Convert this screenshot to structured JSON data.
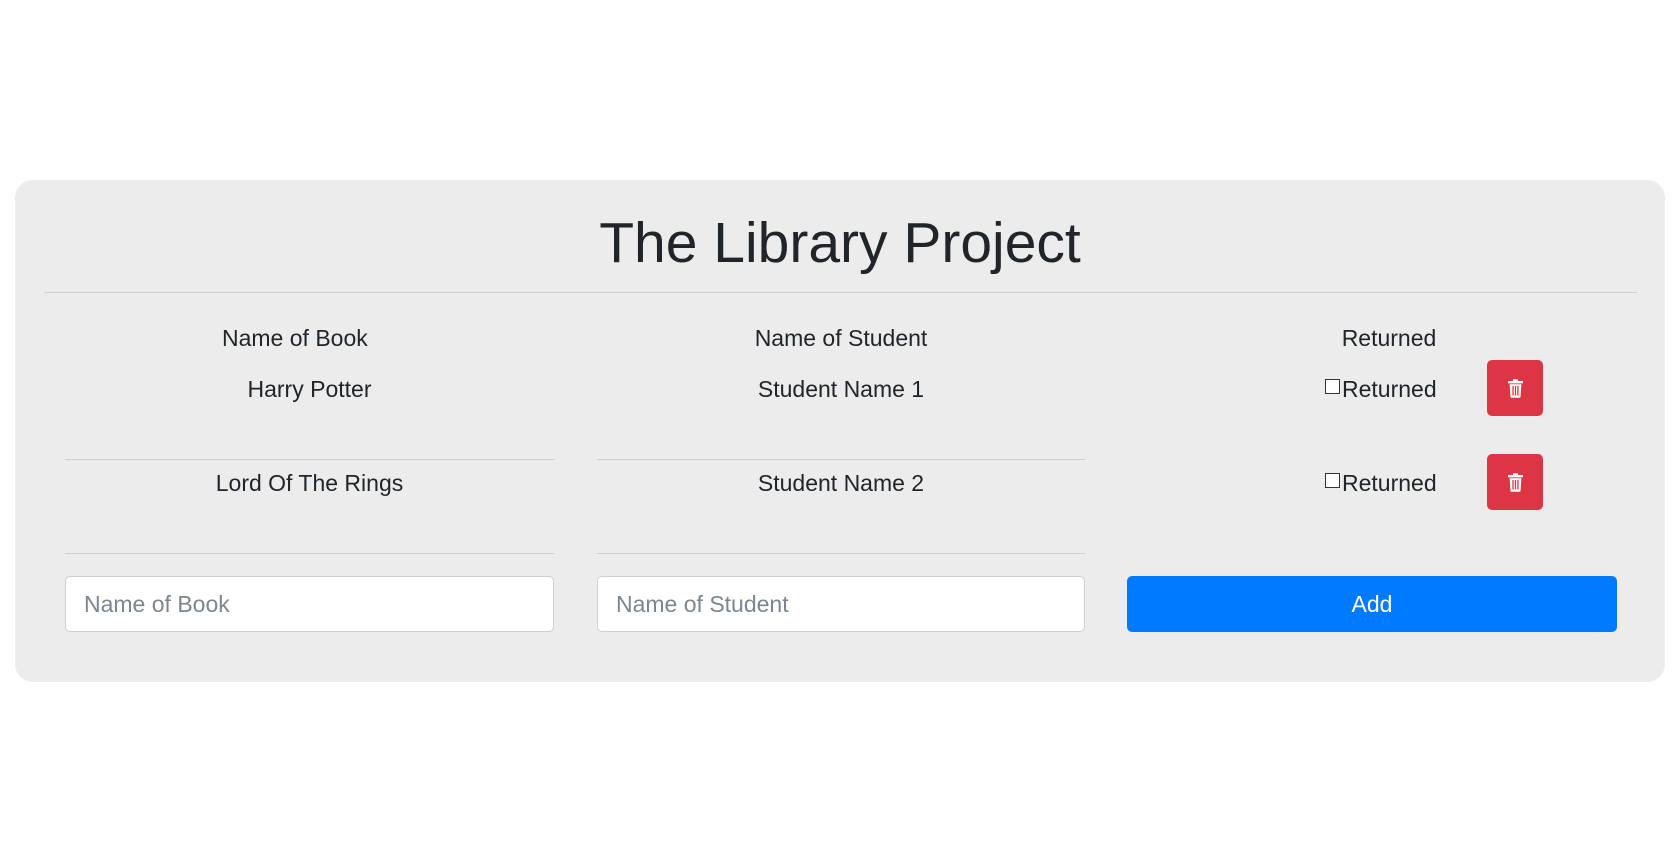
{
  "title": "The Library Project",
  "table": {
    "headers": {
      "book": "Name of Book",
      "student": "Name of Student",
      "returned": "Returned"
    },
    "rows": [
      {
        "book": "Harry Potter",
        "student": "Student Name 1",
        "returned_label": "Returned",
        "returned": false
      },
      {
        "book": "Lord Of The Rings",
        "student": "Student Name 2",
        "returned_label": "Returned",
        "returned": false
      }
    ]
  },
  "form": {
    "book_placeholder": "Name of Book",
    "student_placeholder": "Name of Student",
    "add_label": "Add"
  },
  "icons": {
    "delete": "trash-icon"
  },
  "colors": {
    "card_bg": "#ececec",
    "delete_button": "#dc3545",
    "add_button": "#007bff"
  }
}
